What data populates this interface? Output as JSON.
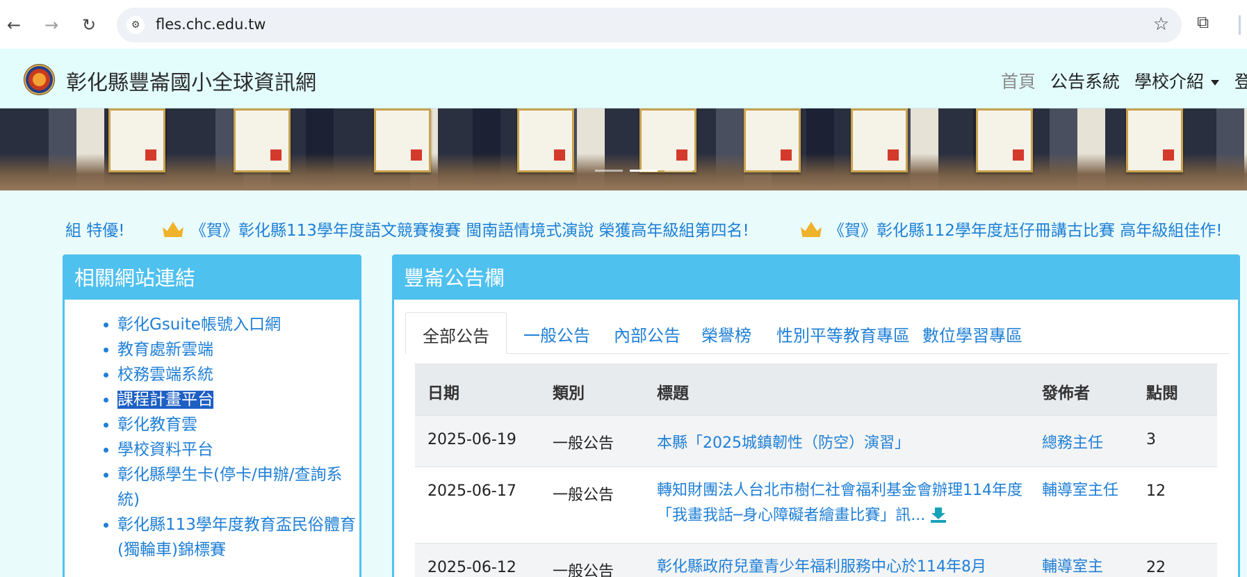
{
  "browser": {
    "url": "fles.chc.edu.tw",
    "back_icon": "←",
    "forward_icon": "→",
    "reload_icon": "↻",
    "site_info_icon": "⚙",
    "star_icon": "☆",
    "extension_icon": "⧉"
  },
  "site": {
    "title": "彰化縣豐崙國小全球資訊網",
    "menu": {
      "home": "首頁",
      "announcements": "公告系統",
      "school_intro": "學校介紹",
      "login": "登"
    }
  },
  "marquee": {
    "items": [
      "組 特優!",
      "《賀》彰化縣113學年度語文競賽複賽 閩南語情境式演說 榮獲高年級組第四名!",
      "《賀》彰化縣112學年度尪仔冊講古比賽 高年級組佳作!"
    ]
  },
  "links_panel": {
    "heading": "相關網站連結",
    "items": [
      "彰化Gsuite帳號入口網",
      "教育處新雲端",
      "校務雲端系統",
      "課程計畫平台",
      "彰化教育雲",
      "學校資料平台",
      "彰化縣學生卡(停卡/申辦/查詢系統)",
      "彰化縣113學年度教育盃民俗體育(獨輪車)錦標賽"
    ]
  },
  "news_panel": {
    "heading": "豐崙公告欄",
    "tabs": [
      "全部公告",
      "一般公告",
      "內部公告",
      "榮譽榜",
      "性別平等教育專區",
      "數位學習專區"
    ],
    "columns": [
      "日期",
      "類別",
      "標題",
      "發佈者",
      "點閱"
    ],
    "rows": [
      {
        "date": "2025-06-19",
        "category": "一般公告",
        "title": "本縣「2025城鎮韌性（防空）演習」",
        "publisher": "總務主任",
        "views": "3"
      },
      {
        "date": "2025-06-17",
        "category": "一般公告",
        "title": "轉知財團法人台北市樹仁社會福利基金會辦理114年度「我畫我話─身心障礙者繪畫比賽」訊...",
        "publisher": "輔導室主任",
        "views": "12"
      },
      {
        "date": "2025-06-12",
        "category": "一般公告",
        "title": "彰化縣政府兒童青少年福利服務中心於114年8月",
        "publisher": "輔導室主",
        "views": "22"
      }
    ]
  }
}
